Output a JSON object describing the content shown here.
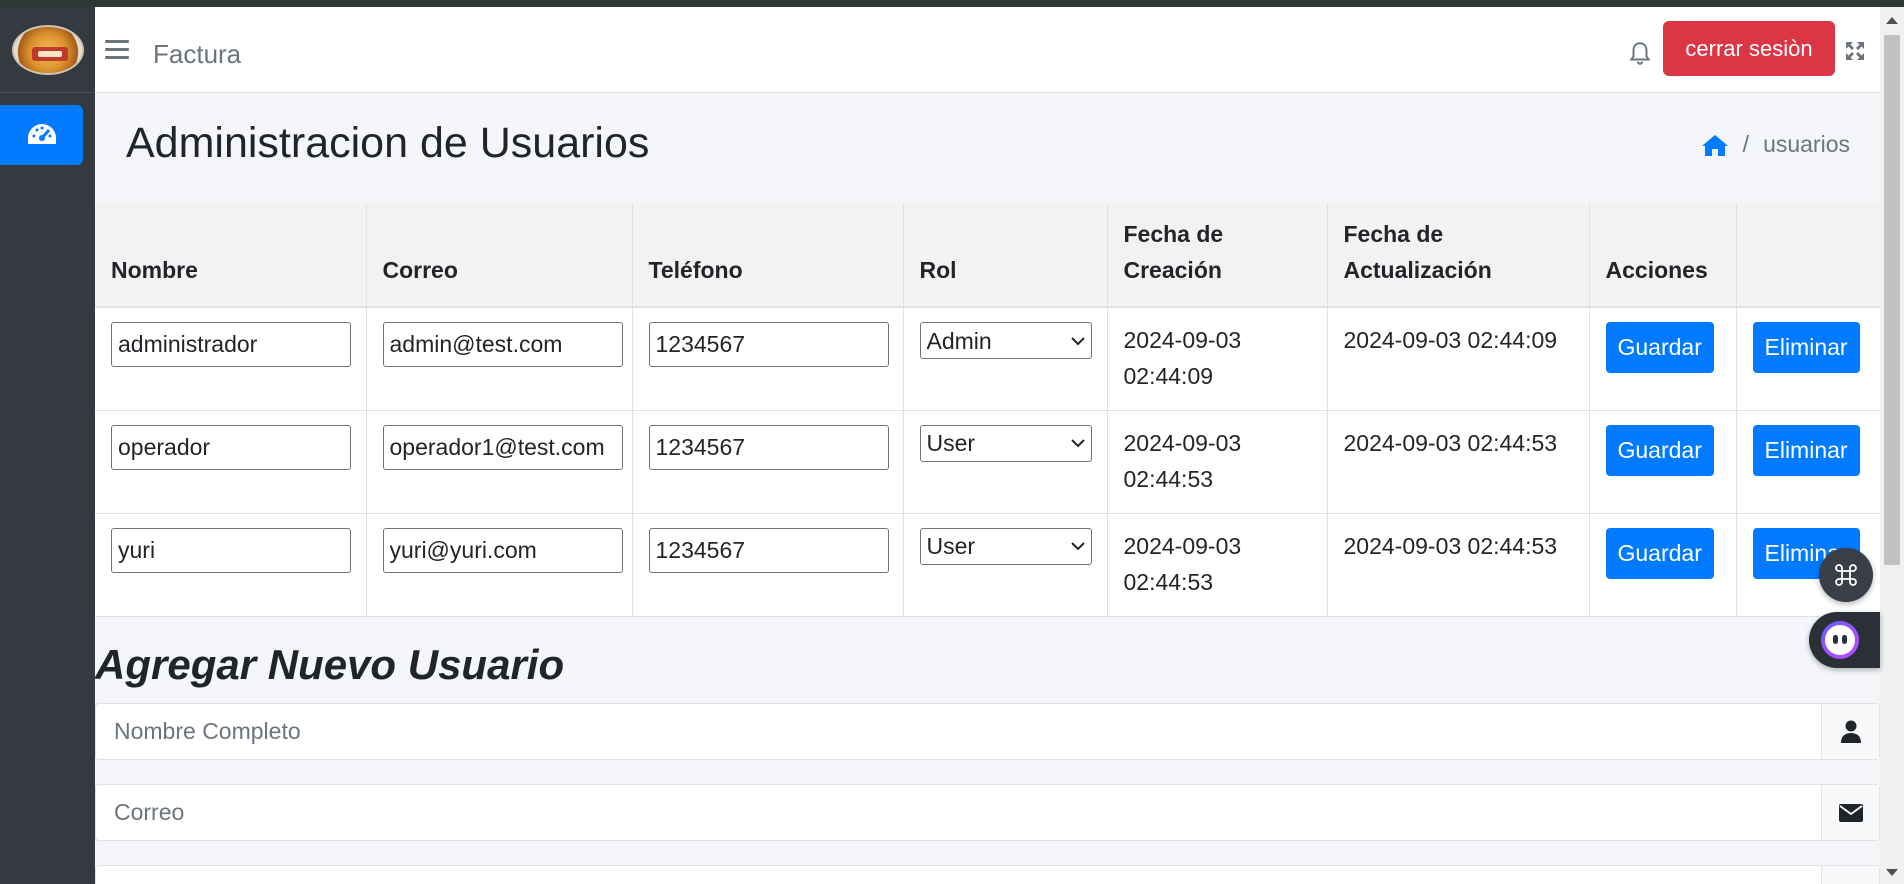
{
  "navbar": {
    "title": "Factura",
    "logout_label": "cerrar sesiòn"
  },
  "page": {
    "title": "Administracion de Usuarios",
    "breadcrumb_current": "usuarios",
    "breadcrumb_sep": "/"
  },
  "table": {
    "headers": [
      "Nombre",
      "Correo",
      "Teléfono",
      "Rol",
      "Fecha de Creación",
      "Fecha de Actualización",
      "Acciones",
      ""
    ],
    "save_label": "Guardar",
    "delete_label": "Eliminar",
    "rows": [
      {
        "nombre": "administrador",
        "correo": "admin@test.com",
        "telefono": "1234567",
        "rol": "Admin",
        "creacion": "2024-09-03 02:44:09",
        "actualizacion": "2024-09-03 02:44:09"
      },
      {
        "nombre": "operador",
        "correo": "operador1@test.com",
        "telefono": "1234567",
        "rol": "User",
        "creacion": "2024-09-03 02:44:53",
        "actualizacion": "2024-09-03 02:44:53"
      },
      {
        "nombre": "yuri",
        "correo": "yuri@yuri.com",
        "telefono": "1234567",
        "rol": "User",
        "creacion": "2024-09-03 02:44:53",
        "actualizacion": "2024-09-03 02:44:53"
      }
    ]
  },
  "form": {
    "title": "Agregar Nuevo Usuario",
    "name_placeholder": "Nombre Completo",
    "email_placeholder": "Correo"
  },
  "colors": {
    "primary": "#007bff",
    "danger": "#dc3545",
    "sidebar": "#343a40"
  }
}
